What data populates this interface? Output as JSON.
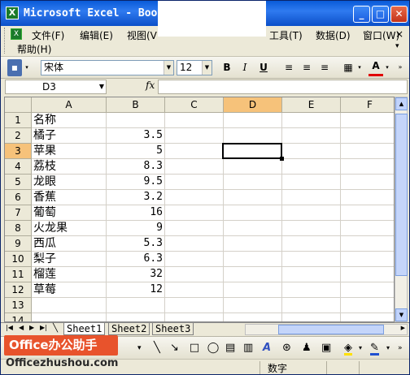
{
  "title": "Microsoft Excel - Boo",
  "menu": [
    {
      "label": "文件(F)"
    },
    {
      "label": "编辑(E)"
    },
    {
      "label": "视图(V"
    },
    {
      "label": "工具(T)"
    },
    {
      "label": "数据(D)"
    },
    {
      "label": "窗口(W)"
    },
    {
      "label": "帮助(H)"
    }
  ],
  "toolbar": {
    "font": "宋体",
    "size": "12",
    "bold": "B",
    "italic": "I",
    "underline": "U",
    "font_color": "A"
  },
  "namebox": "D3",
  "fx": "fx",
  "columns": [
    "A",
    "B",
    "C",
    "D",
    "E",
    "F"
  ],
  "rows": [
    "1",
    "2",
    "3",
    "4",
    "5",
    "6",
    "7",
    "8",
    "9",
    "10",
    "11",
    "12",
    "13",
    "14"
  ],
  "cells": [
    {
      "a": "名称",
      "b": ""
    },
    {
      "a": "橘子",
      "b": "3.5"
    },
    {
      "a": "苹果",
      "b": "5"
    },
    {
      "a": "荔枝",
      "b": "8.3"
    },
    {
      "a": "龙眼",
      "b": "9.5"
    },
    {
      "a": "香蕉",
      "b": "3.2"
    },
    {
      "a": "葡萄",
      "b": "16"
    },
    {
      "a": "火龙果",
      "b": "9"
    },
    {
      "a": "西瓜",
      "b": "5.3"
    },
    {
      "a": "梨子",
      "b": "6.3"
    },
    {
      "a": "榴莲",
      "b": "32"
    },
    {
      "a": "草莓",
      "b": "12"
    }
  ],
  "sheets": [
    "Sheet1",
    "Sheet2",
    "Sheet3"
  ],
  "status": "数字",
  "watermark": {
    "badge": "Office办公助手",
    "site": "Officezhushou.com"
  }
}
